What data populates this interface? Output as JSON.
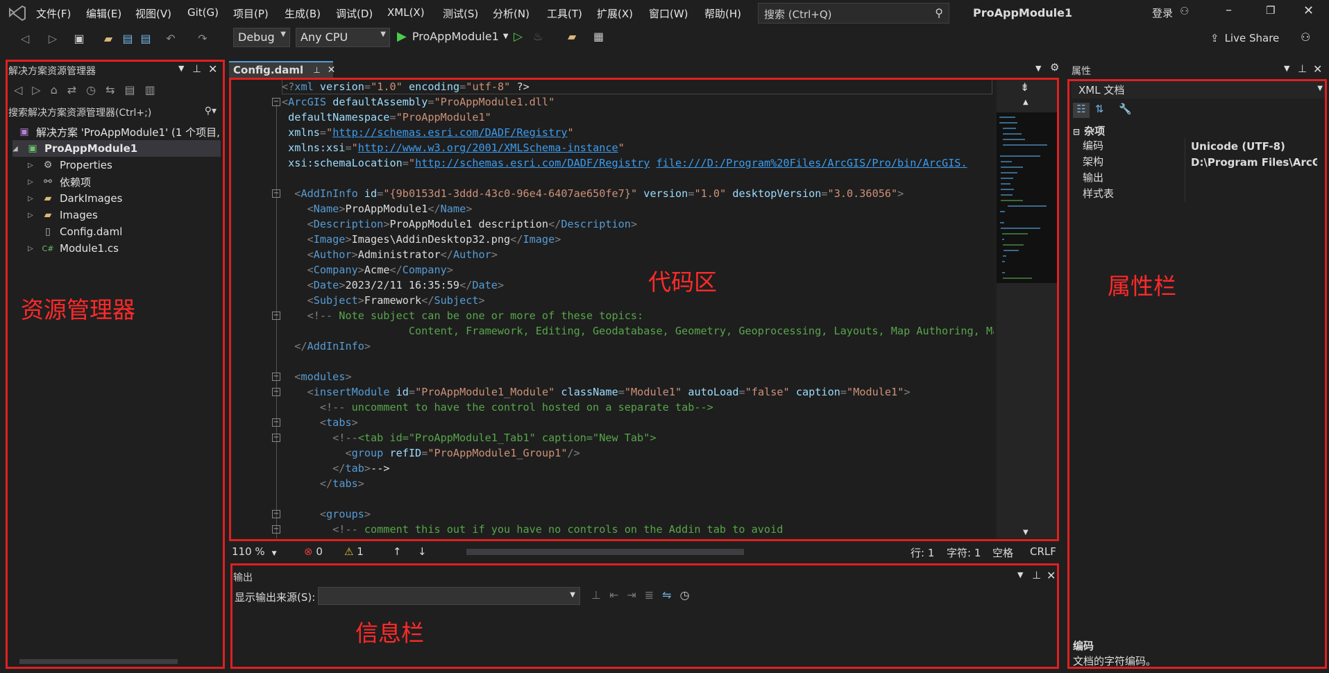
{
  "menubar": {
    "items": [
      "文件(F)",
      "编辑(E)",
      "视图(V)",
      "Git(G)",
      "项目(P)",
      "生成(B)",
      "调试(D)",
      "XML(X)",
      "测试(S)",
      "分析(N)",
      "工具(T)",
      "扩展(X)",
      "窗口(W)",
      "帮助(H)"
    ],
    "search_placeholder": "搜索 (Ctrl+Q)",
    "project_title": "ProAppModule1",
    "login": "登录"
  },
  "toolbar": {
    "config": "Debug",
    "platform": "Any CPU",
    "start_target": "ProAppModule1",
    "live_share": "Live Share"
  },
  "solution_explorer": {
    "title": "解决方案资源管理器",
    "search_placeholder": "搜索解决方案资源管理器(Ctrl+;)",
    "solution_label": "解决方案 'ProAppModule1' (1 个项目,",
    "project": "ProAppModule1",
    "items": [
      {
        "label": "Properties",
        "icon": "wrench-icon"
      },
      {
        "label": "依赖项",
        "icon": "dependencies-icon"
      },
      {
        "label": "DarkImages",
        "icon": "folder-icon"
      },
      {
        "label": "Images",
        "icon": "folder-icon"
      },
      {
        "label": "Config.daml",
        "icon": "file-icon"
      },
      {
        "label": "Module1.cs",
        "icon": "csharp-icon"
      }
    ]
  },
  "editor": {
    "tab": "Config.daml",
    "zoom": "110 %",
    "errors": "0",
    "warnings": "1",
    "line": "行: 1",
    "char": "字符: 1",
    "indent": "空格",
    "eol": "CRLF",
    "lines": [
      "<?xml version=\"1.0\" encoding=\"utf-8\" ?>",
      "<ArcGIS defaultAssembly=\"ProAppModule1.dll\"",
      "        defaultNamespace=\"ProAppModule1\"",
      "        xmlns=\"http://schemas.esri.com/DADF/Registry\"",
      "        xmlns:xsi=\"http://www.w3.org/2001/XMLSchema-instance\"",
      "        xsi:schemaLocation=\"http://schemas.esri.com/DADF/Registry file:///D:/Program%20Files/ArcGIS/Pro/bin/ArcGIS.",
      "",
      "  <AddInInfo id=\"{9b0153d1-3ddd-43c0-96e4-6407ae650fe7}\" version=\"1.0\" desktopVersion=\"3.0.36056\">",
      "    <Name>ProAppModule1</Name>",
      "    <Description>ProAppModule1 description</Description>",
      "    <Image>Images\\AddinDesktop32.png</Image>",
      "    <Author>Administrator</Author>",
      "    <Company>Acme</Company>",
      "    <Date>2023/2/11 16:35:59</Date>",
      "    <Subject>Framework</Subject>",
      "    <!-- Note subject can be one or more of these topics:",
      "                    Content, Framework, Editing, Geodatabase, Geometry, Geoprocessing, Layouts, Map Authoring, Map",
      "  </AddInInfo>",
      "",
      "  <modules>",
      "    <insertModule id=\"ProAppModule1_Module\" className=\"Module1\" autoLoad=\"false\" caption=\"Module1\">",
      "      <!-- uncomment to have the control hosted on a separate tab-->",
      "      <tabs>",
      "        <!--<tab id=\"ProAppModule1_Tab1\" caption=\"New Tab\">",
      "          <group refID=\"ProAppModule1_Group1\"/>",
      "        </tab>-->",
      "      </tabs>",
      "",
      "      <groups>",
      "        <!-- comment this out if you have no controls on the Addin tab to avoid"
    ]
  },
  "output": {
    "title": "输出",
    "source_label": "显示输出来源(S):"
  },
  "properties": {
    "title": "属性",
    "object": "XML 文档",
    "category": "杂项",
    "rows": [
      {
        "name": "编码",
        "value": "Unicode (UTF-8)"
      },
      {
        "name": "架构",
        "value": "D:\\Program Files\\ArcGIS\\"
      },
      {
        "name": "输出",
        "value": ""
      },
      {
        "name": "样式表",
        "value": ""
      }
    ],
    "desc_title": "编码",
    "desc_text": "文档的字符编码。"
  },
  "annotations": {
    "explorer": "资源管理器",
    "code": "代码区",
    "properties": "属性栏",
    "output": "信息栏"
  },
  "colors": {
    "annotation": "#e02020",
    "tag": "#569cd6",
    "attr": "#9cdcfe",
    "string": "#ce9178",
    "comment": "#57a64a",
    "link": "#3c9cf0"
  }
}
